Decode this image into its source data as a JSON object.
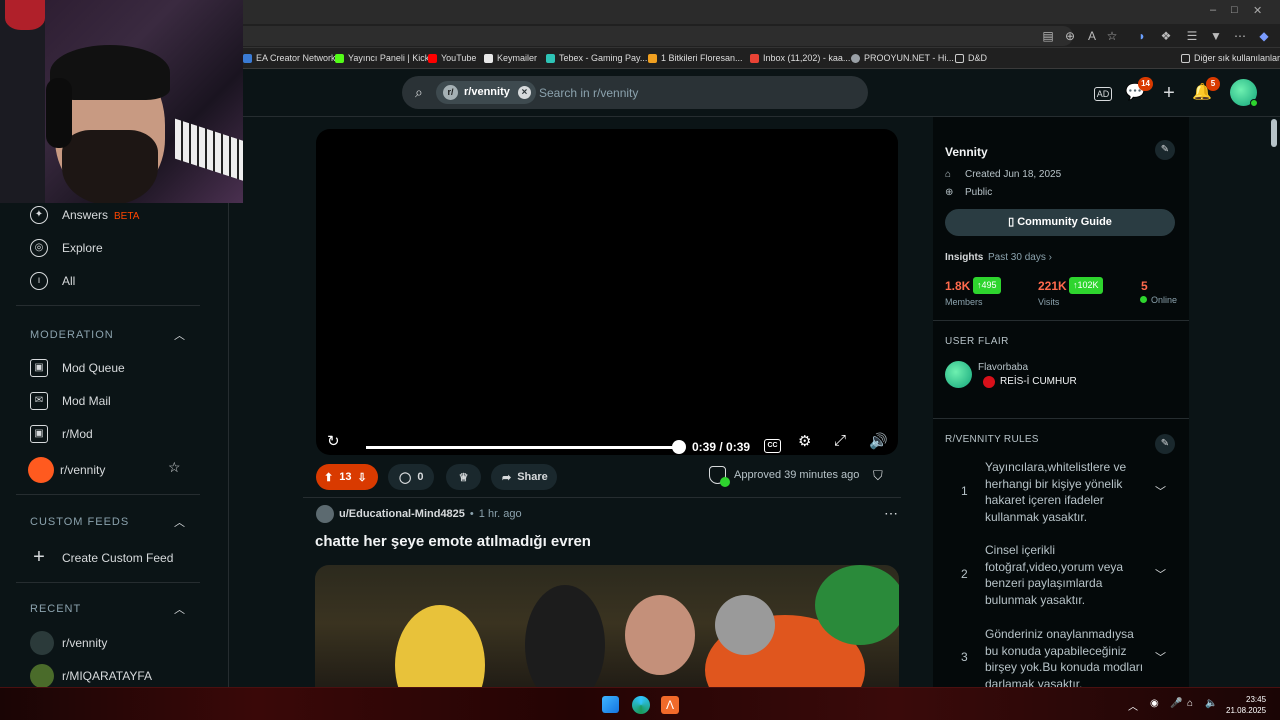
{
  "browser": {
    "window_controls": [
      "–",
      "□",
      "✕"
    ],
    "bookmarks": [
      {
        "label": "EA Creator Network",
        "color": "#3a7bd5"
      },
      {
        "label": "Yayıncı Paneli | Kick",
        "color": "#53fc18"
      },
      {
        "label": "YouTube",
        "color": "#ff0000"
      },
      {
        "label": "Keymailer",
        "color": "#e8e8e8"
      },
      {
        "label": "Tebex - Gaming Pay...",
        "color": "#2ec4b6"
      },
      {
        "label": "1 Bitkileri Floresan...",
        "color": "#f0a020"
      },
      {
        "label": "Inbox (11,202) - kaa...",
        "color": "#ea4335"
      },
      {
        "label": "PROOYUN.NET - Hi...",
        "color": "#9aa0a6"
      },
      {
        "label": "D&D",
        "color": "#9aa0a6"
      }
    ],
    "other_bookmarks": "Diğer sık kullanılanlar"
  },
  "header": {
    "search_chip": "r/vennity",
    "search_placeholder": "Search in r/vennity",
    "chat_badge": "14",
    "notif_badge": "5"
  },
  "left_nav": {
    "answers": "Answers",
    "beta": "BETA",
    "explore": "Explore",
    "all": "All",
    "moderation_title": "MODERATION",
    "mod_queue": "Mod Queue",
    "mod_mail": "Mod Mail",
    "r_mod": "r/Mod",
    "r_vennity": "r/vennity",
    "custom_feeds_title": "CUSTOM FEEDS",
    "create_custom_feed": "Create Custom Feed",
    "recent_title": "RECENT",
    "recent": [
      "r/vennity",
      "r/MIQARATAYFA"
    ]
  },
  "video": {
    "time": "0:39 / 0:39",
    "cc": "CC",
    "progress": 1.0
  },
  "actions": {
    "votes": "13",
    "comments": "0",
    "share": "Share",
    "approved": "Approved 39 minutes ago"
  },
  "next_post": {
    "author": "u/Educational-Mind4825",
    "age": "1 hr. ago",
    "title": "chatte her şeye emote atılmadığı evren"
  },
  "sidebar": {
    "community": "Vennity",
    "created": "Created Jun 18, 2025",
    "visibility": "Public",
    "guide": "Community Guide",
    "insights": "Insights",
    "insights_range": "Past 30 days",
    "members_num": "1.8K",
    "members_delta": "↑495",
    "members_lbl": "Members",
    "visits_num": "221K",
    "visits_delta": "↑102K",
    "visits_lbl": "Visits",
    "online_num": "5",
    "online_lbl": "Online",
    "user_flair_title": "USER FLAIR",
    "flair_user": "Flavorbaba",
    "flair_text": "REİS-İ CUMHUR",
    "rules_title": "R/VENNITY RULES",
    "rules": [
      {
        "n": "1",
        "text": "Yayıncılara,whitelistlere ve herhangi bir kişiye yönelik hakaret içeren ifadeler kullanmak yasaktır."
      },
      {
        "n": "2",
        "text": "Cinsel içerikli fotoğraf,video,yorum veya benzeri paylaşımlarda bulunmak yasaktır."
      },
      {
        "n": "3",
        "text": "Gönderiniz onaylanmadıysa bu konuda yapabileceğiniz birşey yok.Bu konuda modları darlamak yasaktır."
      }
    ]
  },
  "taskbar": {
    "time": "23:45",
    "date": "21.08.2025"
  },
  "colors": {
    "background": "#0b1416",
    "accent": "#ff4500",
    "upvote_pill": "#d93a00",
    "online": "#2ed52e"
  }
}
